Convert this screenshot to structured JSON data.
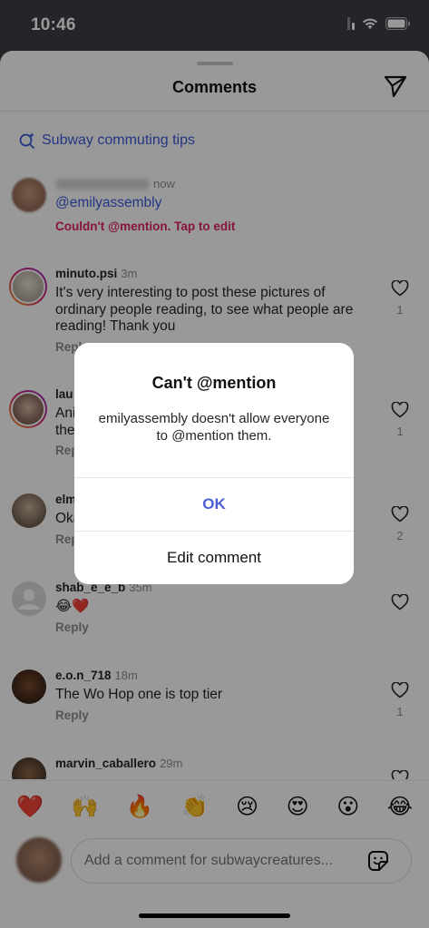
{
  "status_bar": {
    "time": "10:46"
  },
  "sheet": {
    "title": "Comments"
  },
  "search_tip": {
    "label": "Subway commuting tips"
  },
  "pending_comment": {
    "time": "now",
    "mention": "@emilyassembly",
    "error": "Couldn't @mention. Tap to edit"
  },
  "comments": [
    {
      "username": "minuto.psi",
      "time": "3m",
      "text": "It's very interesting to post these pictures of ordinary people reading, to see what people are reading! Thank you",
      "reply": "Reply",
      "likes": "1"
    },
    {
      "username": "lau",
      "time": "",
      "text": "Ani",
      "text2": "the",
      "reply": "Rep",
      "likes": "1"
    },
    {
      "username": "elm",
      "time": "",
      "text": "Oka",
      "reply": "Rep",
      "likes": "2"
    },
    {
      "username": "shab_e_e_b",
      "time": "35m",
      "text": "😂❤️",
      "reply": "Reply",
      "likes": ""
    },
    {
      "username": "e.o.n_718",
      "time": "18m",
      "text": "The Wo Hop one is top tier",
      "reply": "Reply",
      "likes": "1"
    },
    {
      "username": "marvin_caballero",
      "time": "29m",
      "text": "",
      "reply": "",
      "likes": ""
    }
  ],
  "emoji_bar": [
    "❤️",
    "🙌",
    "🔥",
    "👏",
    "😢",
    "😍",
    "😮",
    "😂"
  ],
  "comment_input": {
    "placeholder": "Add a comment for subwaycreatures..."
  },
  "alert": {
    "title": "Can't @mention",
    "message": "emilyassembly doesn't allow everyone to @mention them.",
    "ok_label": "OK",
    "edit_label": "Edit comment"
  },
  "colors": {
    "link_blue": "#3b5bdb",
    "error_red": "#e0245e",
    "ok_blue": "#4a5fd6"
  }
}
